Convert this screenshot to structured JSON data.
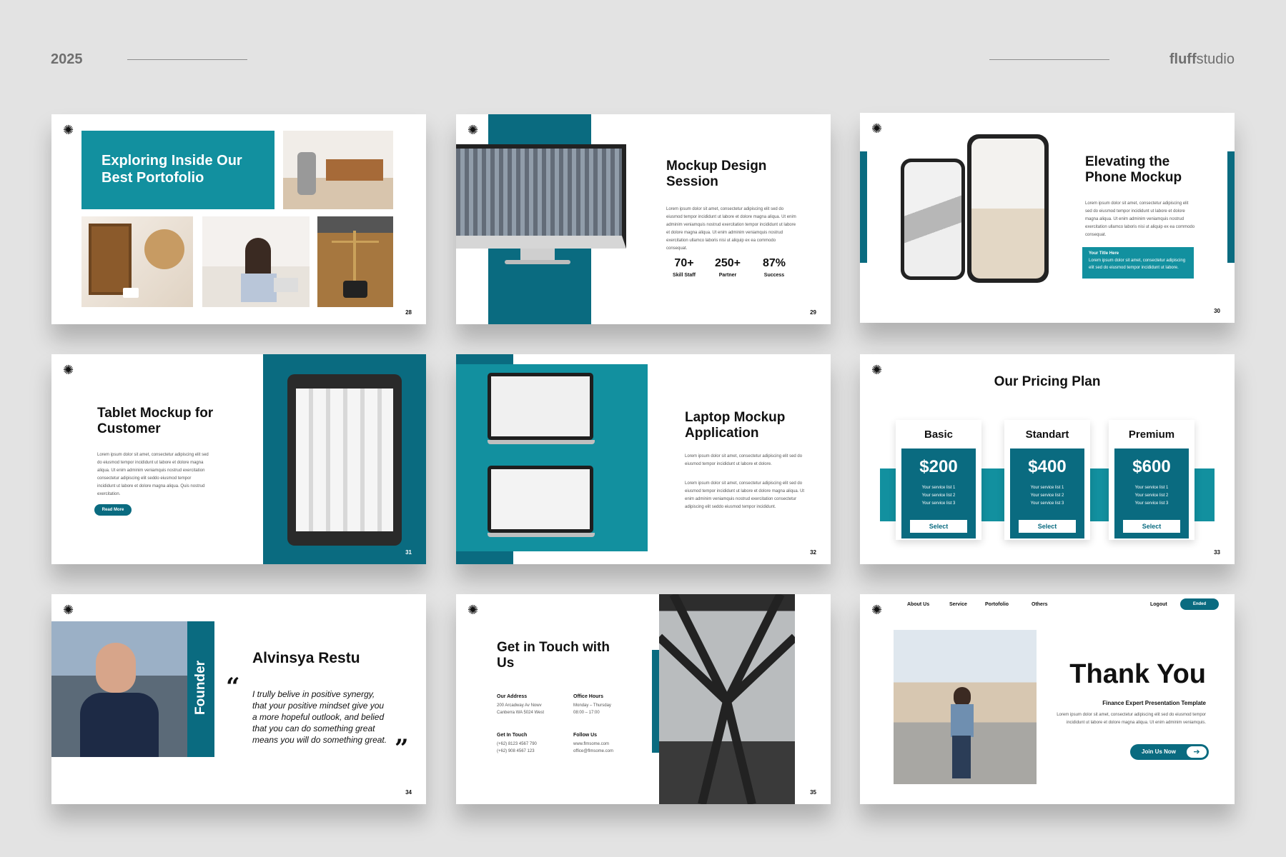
{
  "header": {
    "year": "2025",
    "brand_bold": "fluff",
    "brand_rest": "studio"
  },
  "slides": {
    "s1": {
      "title": "Exploring Inside Our Best Portofolio",
      "page": "28"
    },
    "s2": {
      "title": "Mockup Design Session",
      "body": "Lorem ipsum dolor sit amet, consectetur adipiscing elit sed do eiusmod tempor incididunt ut labore et dolore magna aliqua. Ut enim adminim veniamquis nostrud exercitation tempor incididunt ut labore et dolore magna aliqua. Ut enim adminim veniamquis nostrud exercitation ullamco laboris nisi ut aliquip ex ea commodo consequat.",
      "stats": [
        {
          "value": "70+",
          "label": "Skill Staff"
        },
        {
          "value": "250+",
          "label": "Partner"
        },
        {
          "value": "87%",
          "label": "Success"
        }
      ],
      "page": "29"
    },
    "s3": {
      "title": "Elevating the Phone Mockup",
      "body": "Lorem ipsum dolor sit amet, consectetur adipiscing elit sed do eiusmod tempor incididunt ut labore et dolore magna aliqua. Ut enim adminim veniamquis nostrud exercitation ullamco laboris nisi ut aliquip ex ea commodo consequat.",
      "box_title": "Your Title Here",
      "box_body": "Lorem ipsum dolor sit amet, consectetur adipiscing elit sed do eiusmod tempor incididunt ut labore.",
      "page": "30"
    },
    "s4": {
      "title": "Tablet Mockup for Customer",
      "body": "Lorem ipsum dolor sit amet, consectetur adipiscing elit sed do eiusmod tempor incididunt ut labore et dolore magna aliqua. Ut enim adminim veniamquis nostrud exercitation consectetur adipiscing elit seddo eiusmod tempor incididunt ut labore et dolore magna aliqua. Quis nostrud exercitation.",
      "button": "Read More",
      "page": "31"
    },
    "s5": {
      "title": "Laptop Mockup Application",
      "body1": "Lorem ipsum dolor sit amet, consectetur adipiscing elit sed do eiusmod tempor incididunt ut labore et dolore.",
      "body2": "Lorem ipsum dolor sit amet, consectetur adipiscing elit sed do eiusmod tempor incididunt ut labore et dolore magna aliqua. Ut enim adminim veniamquis nostrud exercitation consectetur adipiscing elit seddo eiusmod tempor incididunt.",
      "page": "32"
    },
    "s6": {
      "title": "Our Pricing Plan",
      "plans": [
        {
          "name": "Basic",
          "price": "$200",
          "features": [
            "Your service list 1",
            "Your service list 2",
            "Your service list 3"
          ],
          "button": "Select"
        },
        {
          "name": "Standart",
          "price": "$400",
          "features": [
            "Your service list 1",
            "Your service list 2",
            "Your service list 3"
          ],
          "button": "Select"
        },
        {
          "name": "Premium",
          "price": "$600",
          "features": [
            "Your service list 1",
            "Your service list 2",
            "Your service list 3"
          ],
          "button": "Select"
        }
      ],
      "page": "33"
    },
    "s7": {
      "name": "Alvinsya Restu",
      "role": "Founder",
      "quote": "I trully belive in positive synergy, that your positive mindset give you a more hopeful outlook, and belied that you can do something great means you will do something great.",
      "open_quote": "“",
      "close_quote": "”",
      "page": "34"
    },
    "s8": {
      "title": "Get in Touch with Us",
      "address_h": "Our Address",
      "address": [
        "200 Arcadway Av Nowv",
        "Canberra WA 5024 West"
      ],
      "hours_h": "Office Hours",
      "hours": [
        "Monday – Thursday",
        "08:00 – 17:00"
      ],
      "touch_h": "Get In Touch",
      "touch": [
        "(+62) 8123 4567 790",
        "(+62) 908 4567 123"
      ],
      "follow_h": "Follow Us",
      "follow": [
        "www.flmsome.com",
        "office@flmsome.com"
      ],
      "page": "35"
    },
    "s9": {
      "nav": [
        "About Us",
        "Service",
        "Portofolio",
        "Others"
      ],
      "logout": "Logout",
      "ended": "Ended",
      "title": "Thank You",
      "subtitle": "Finance Expert Presentation Template",
      "body": "Lorem ipsum dolor sit amet, consectetur adipiscing elit sed do eiusmod tempor incididunt ut labore et dolore magna aliqua. Ut enim adminim veniamquis.",
      "cta": "Join Us Now"
    }
  },
  "colors": {
    "teal": "#12909f",
    "dark_teal": "#0a6b80",
    "background": "#e3e3e3"
  }
}
